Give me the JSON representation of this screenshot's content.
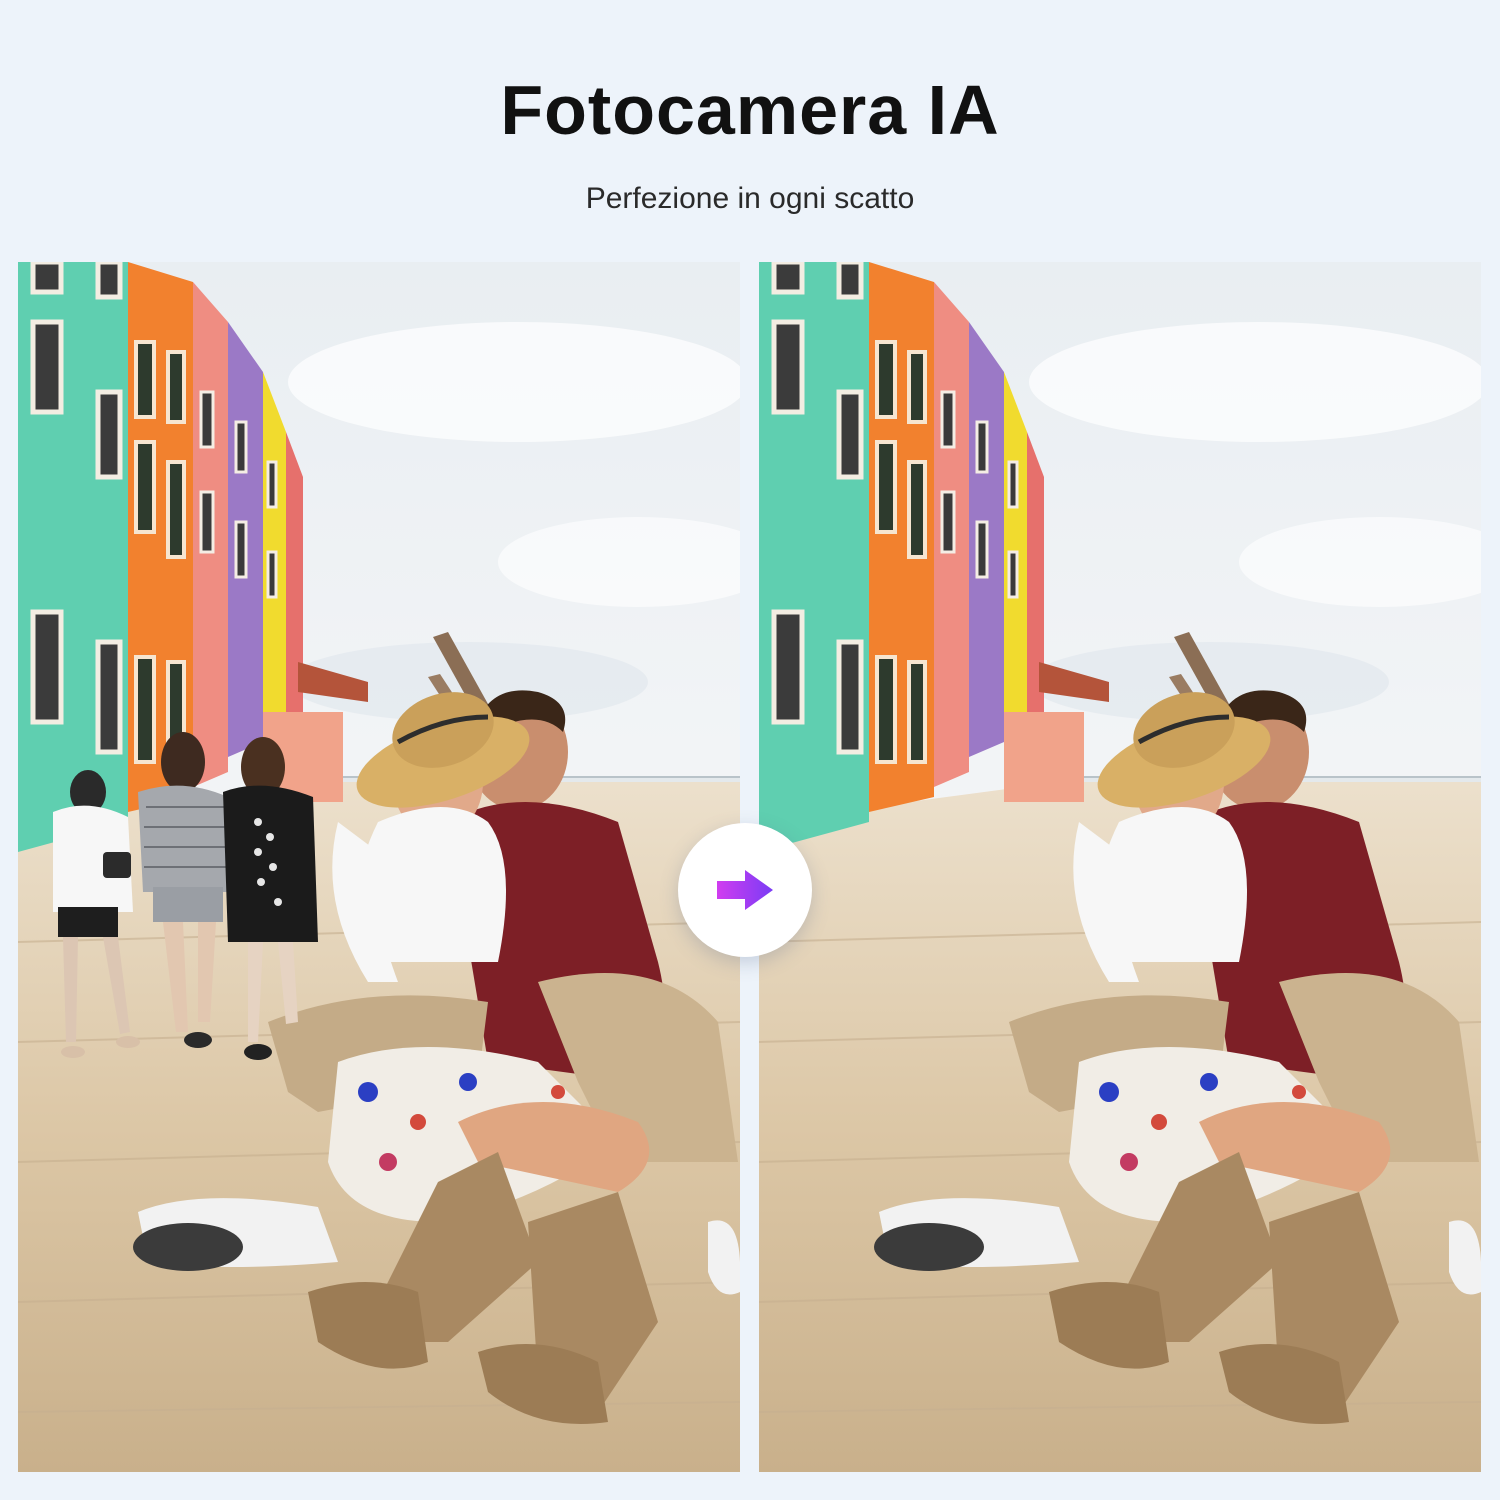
{
  "title": "Fotocamera IA",
  "subtitle": "Perfezione in ogni scatto",
  "panels": {
    "before": {
      "image": "photo-with-passersby"
    },
    "after": {
      "image": "photo-passersby-removed"
    }
  },
  "arrow": {
    "icon": "arrow-right-icon",
    "gradient": [
      "#d13df0",
      "#7a3cf5"
    ]
  },
  "colors": {
    "background": "#edf3fa"
  }
}
